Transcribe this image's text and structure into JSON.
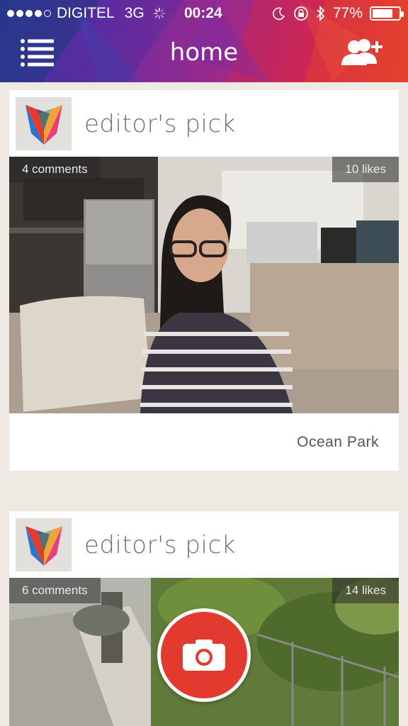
{
  "status_bar": {
    "carrier": "DIGITEL",
    "network": "3G",
    "time": "00:24",
    "battery_percent": "77%",
    "battery_level": 0.77
  },
  "navbar": {
    "title": "home"
  },
  "feed": [
    {
      "title": "editor's pick",
      "comments": "4 comments",
      "likes": "10 likes",
      "location": "Ocean Park"
    },
    {
      "title": "editor's pick",
      "comments": "6 comments",
      "likes": "14 likes"
    }
  ],
  "colors": {
    "camera_button": "#e33a30",
    "header_gradient_start": "#2a3c9c",
    "header_gradient_end": "#e8432c"
  },
  "icons": {
    "menu": "list-menu-icon",
    "add_friend": "add-friend-icon",
    "camera": "camera-icon"
  }
}
